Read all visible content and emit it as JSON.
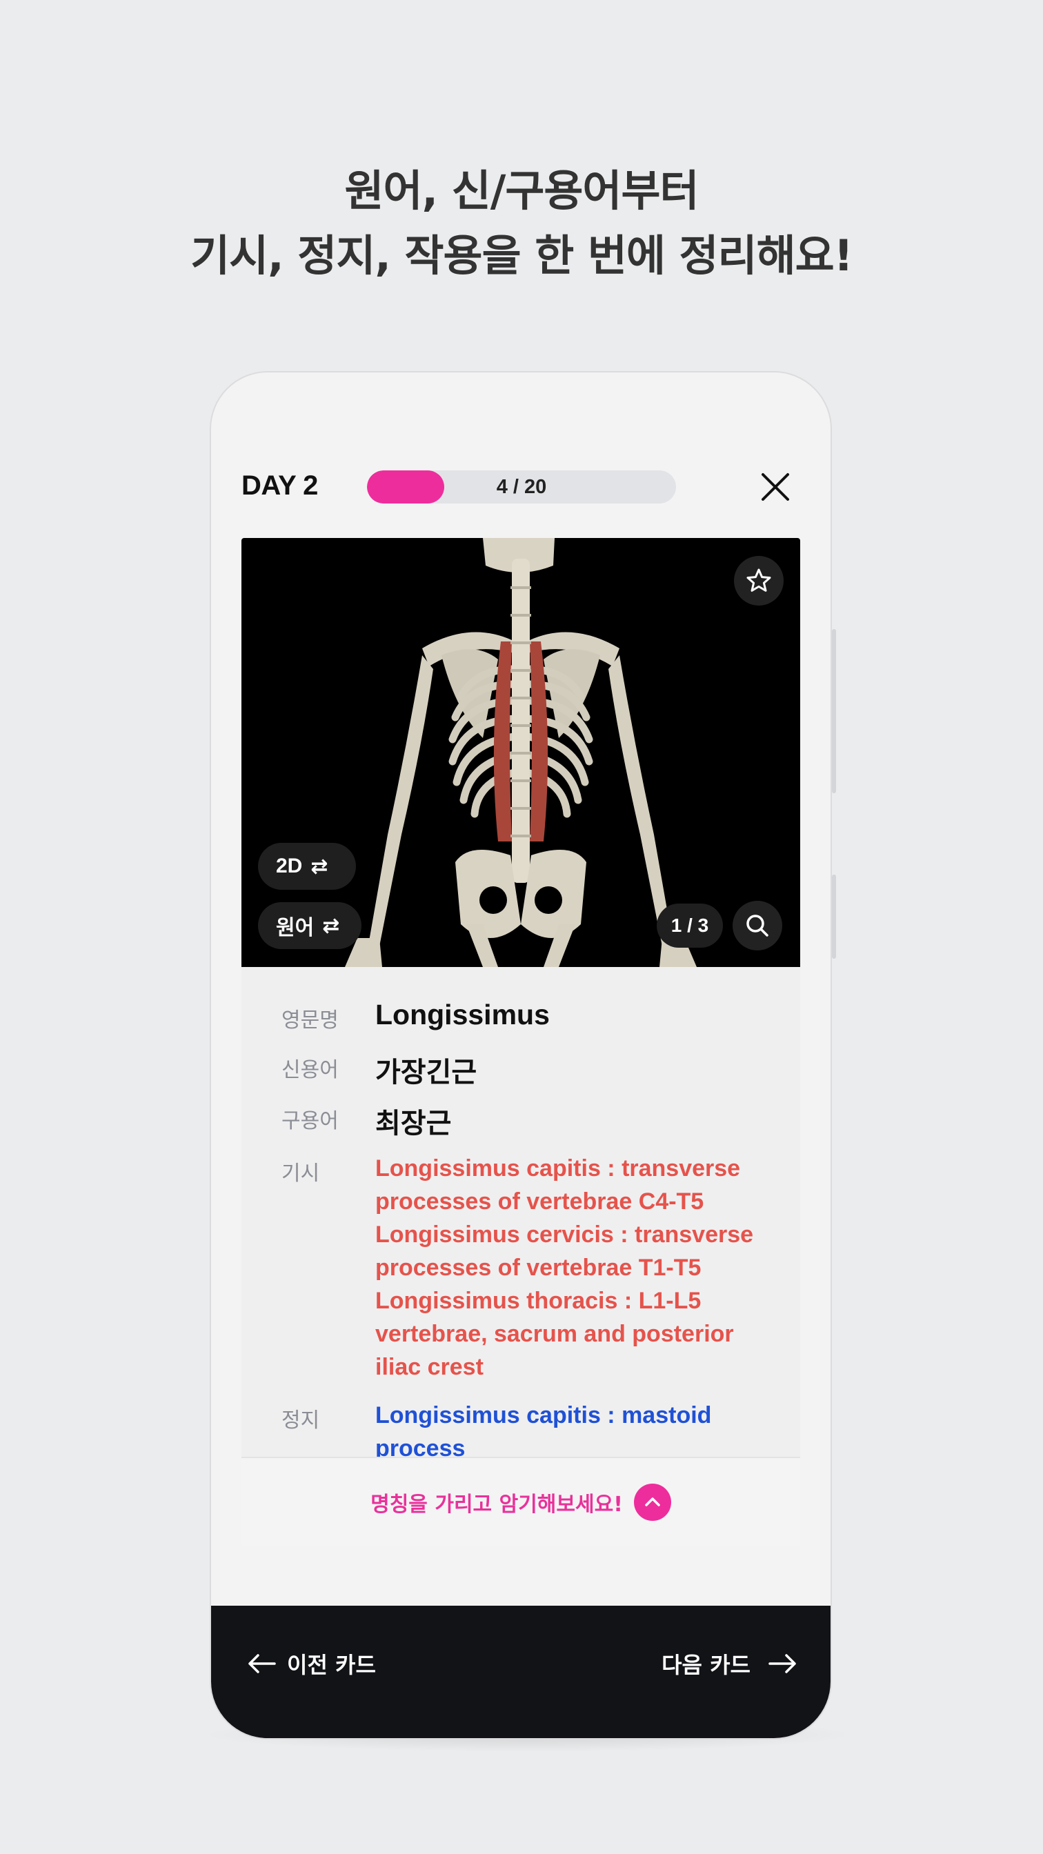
{
  "headline": {
    "line1": "원어, 신/구용어부터",
    "line2": "기시, 정지, 작용을 한 번에 정리해요!"
  },
  "topbar": {
    "day_label": "DAY 2",
    "progress_text": "4 / 20",
    "progress_fraction": 0.2,
    "close_icon": "close-icon"
  },
  "image": {
    "star_icon": "star-icon",
    "view_mode_label": "2D",
    "language_label": "원어",
    "swap_icon": "swap-arrows-icon",
    "counter": "1 / 3",
    "search_icon": "search-icon"
  },
  "info": {
    "english_label": "영문명",
    "english_value": "Longissimus",
    "new_term_label": "신용어",
    "new_term_value": "가장긴근",
    "old_term_label": "구용어",
    "old_term_value": "최장근",
    "origin_label": "기시",
    "origin_lines": [
      "Longissimus capitis :  transverse",
      "processes of vertebrae C4-T5",
      "Longissimus cervicis : transverse",
      "processes of vertebrae T1-T5",
      "Longissimus thoracis : L1-L5",
      "vertebrae, sacrum and posterior",
      "iliac crest"
    ],
    "insertion_label": "정지",
    "insertion_lines": [
      "Longissimus capitis : mastoid",
      "process"
    ]
  },
  "cover_bar": {
    "text": "명칭을 가리고 암기해보세요!",
    "icon": "chevron-up-icon"
  },
  "bottom_nav": {
    "prev_label": "이전 카드",
    "next_label": "다음 카드"
  },
  "colors": {
    "accent": "#ee2d9c",
    "origin_text": "#e5534b",
    "insertion_text": "#1f51d6",
    "nav_bg": "#121317"
  }
}
